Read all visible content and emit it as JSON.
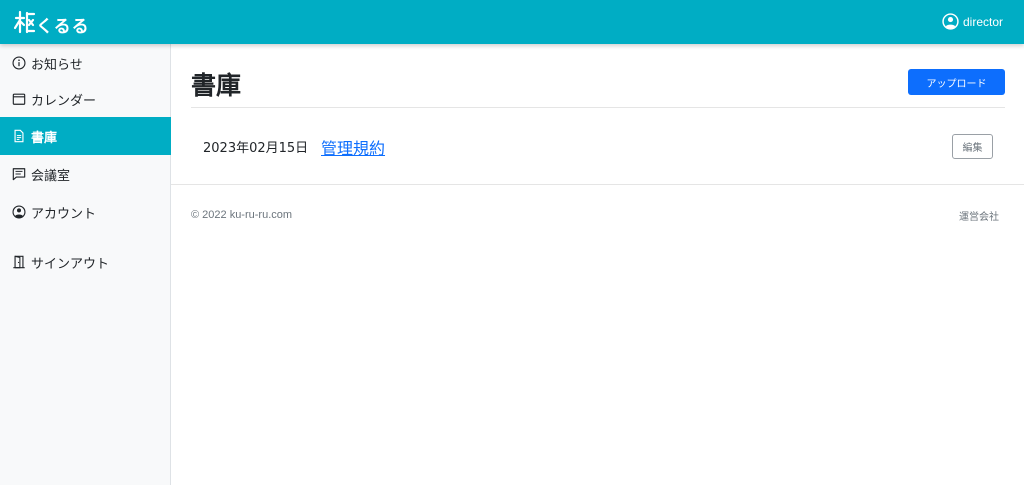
{
  "header": {
    "logo_text": "くるる",
    "username": "director",
    "background": "#00adc4"
  },
  "sidebar": {
    "items": [
      {
        "label": "お知らせ",
        "icon": "info-circle-icon",
        "active": false
      },
      {
        "label": "カレンダー",
        "icon": "calendar-icon",
        "active": false
      },
      {
        "label": "書庫",
        "icon": "file-text-icon",
        "active": true
      },
      {
        "label": "会議室",
        "icon": "chat-icon",
        "active": false
      },
      {
        "label": "アカウント",
        "icon": "person-circle-icon",
        "active": false
      },
      {
        "label": "サインアウト",
        "icon": "door-icon",
        "active": false
      }
    ]
  },
  "main": {
    "title": "書庫",
    "upload_label": "アップロード",
    "files": [
      {
        "date": "2023年02月15日",
        "name": "管理規約",
        "edit_label": "編集"
      }
    ]
  },
  "footer": {
    "copyright": "© 2022 ku-ru-ru.com",
    "company": "運営会社"
  },
  "colors": {
    "accent": "#00adc4",
    "primary": "#0d6efd"
  }
}
